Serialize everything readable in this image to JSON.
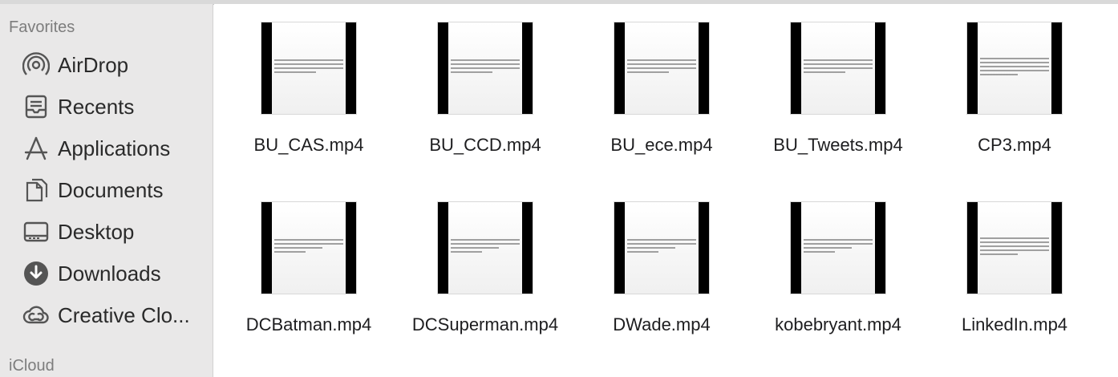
{
  "sidebar": {
    "favorites_title": "Favorites",
    "items": [
      {
        "label": "AirDrop",
        "icon": "airdrop-icon"
      },
      {
        "label": "Recents",
        "icon": "recents-icon"
      },
      {
        "label": "Applications",
        "icon": "applications-icon"
      },
      {
        "label": "Documents",
        "icon": "documents-icon"
      },
      {
        "label": "Desktop",
        "icon": "desktop-icon"
      },
      {
        "label": "Downloads",
        "icon": "downloads-icon"
      },
      {
        "label": "Creative Clo...",
        "icon": "creative-cloud-icon"
      }
    ],
    "icloud_title": "iCloud"
  },
  "files": [
    {
      "name": "BU_CAS.mp4"
    },
    {
      "name": "BU_CCD.mp4"
    },
    {
      "name": "BU_ece.mp4"
    },
    {
      "name": "BU_Tweets.mp4"
    },
    {
      "name": "CP3.mp4"
    },
    {
      "name": "DCBatman.mp4"
    },
    {
      "name": "DCSuperman.mp4"
    },
    {
      "name": "DWade.mp4"
    },
    {
      "name": "kobebryant.mp4"
    },
    {
      "name": "LinkedIn.mp4"
    }
  ]
}
